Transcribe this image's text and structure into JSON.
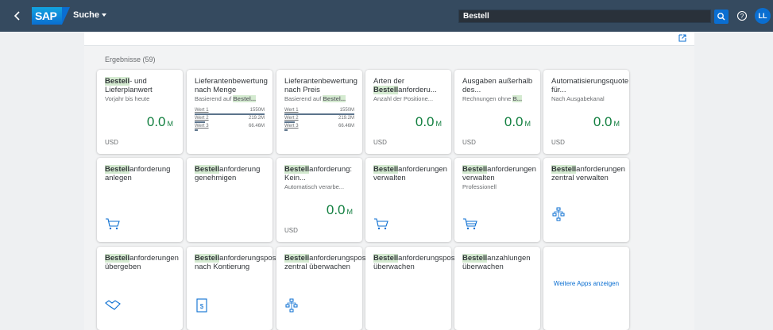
{
  "shell": {
    "brand": "SAP",
    "menu_label": "Suche",
    "search_value": "Bestell",
    "user_initials": "LL"
  },
  "results_label": "Ergebnisse (59)",
  "colors": {
    "shell": "#354a5f",
    "accent": "#0a6ed1",
    "positive": "#107e3e",
    "highlight": "#d4ead0"
  },
  "tiles": [
    {
      "hl": "Bestell",
      "rest": "- und Lieferplanwert",
      "sub": "Vorjahr bis heute",
      "kpi": "0.0",
      "scale": "M",
      "unit": "USD"
    },
    {
      "pre": "Lieferantenbewertung nach Menge",
      "sub_pre": "Basierend auf ",
      "sub_hl": "Bestel...",
      "rows": [
        {
          "label": "Wert 1",
          "value": "1550M",
          "fill": 1.0
        },
        {
          "label": "Wert 2",
          "value": "219.2M",
          "fill": 0.14
        },
        {
          "label": "Wert 3",
          "value": "66.46M",
          "fill": 0.04
        }
      ]
    },
    {
      "pre": "Lieferantenbewertung nach Preis",
      "sub_pre": "Basierend auf ",
      "sub_hl": "Bestel...",
      "rows": [
        {
          "label": "Wert 1",
          "value": "1550M",
          "fill": 1.0
        },
        {
          "label": "Wert 2",
          "value": "219.2M",
          "fill": 0.14
        },
        {
          "label": "Wert 3",
          "value": "66.46M",
          "fill": 0.04
        }
      ]
    },
    {
      "pre": "Arten der ",
      "hl": "Bestell",
      "rest": "anforderu...",
      "sub": "Anzahl der Positione...",
      "kpi": "0.0",
      "scale": "M",
      "unit": "USD"
    },
    {
      "pre": "Ausgaben außerhalb des...",
      "sub_pre": "Rechnungen ohne ",
      "sub_hl": "B...",
      "kpi": "0.0",
      "scale": "M",
      "unit": "USD"
    },
    {
      "pre": "Automatisierungsquote für...",
      "sub": "Nach Ausgabekanal",
      "kpi": "0.0",
      "scale": "M",
      "unit": "USD"
    },
    {
      "hl": "Bestell",
      "rest": "anforderung anlegen",
      "icon": "cart-icon"
    },
    {
      "hl": "Bestell",
      "rest": "anforderung genehmigen"
    },
    {
      "hl": "Bestell",
      "rest": "anforderung: Kein...",
      "sub": "Automatisch verarbe...",
      "kpi": "0.0",
      "scale": "M",
      "unit": "USD"
    },
    {
      "hl": "Bestell",
      "rest": "anforderungen verwalten",
      "icon": "cart-icon"
    },
    {
      "hl": "Bestell",
      "rest": "anforderungen verwalten",
      "sub": "Professionell",
      "icon": "cart-full-icon"
    },
    {
      "hl": "Bestell",
      "rest": "anforderungen zentral verwalten",
      "icon": "org-icon"
    },
    {
      "hl": "Bestell",
      "rest": "anforderungen übergeben",
      "icon": "handshake-icon"
    },
    {
      "hl": "Bestell",
      "rest": "anforderungspositionen nach Kontierung",
      "icon": "document-icon"
    },
    {
      "hl": "Bestell",
      "rest": "anforderungspositionen zentral überwachen",
      "icon": "org-icon"
    },
    {
      "hl": "Bestell",
      "rest": "anforderungspositionen überwachen"
    },
    {
      "hl": "Bestell",
      "rest": "anzahlungen überwachen"
    },
    {
      "more": "Weitere Apps anzeigen"
    }
  ],
  "tile_texts": {
    "t0": {
      "hl": "Bestell",
      "rest": "- und Lieferplanwert"
    },
    "t1": {
      "line": "Lieferantenbewertung nach Menge"
    },
    "t2": {
      "line": "Lieferantenbewertung nach Preis"
    }
  }
}
